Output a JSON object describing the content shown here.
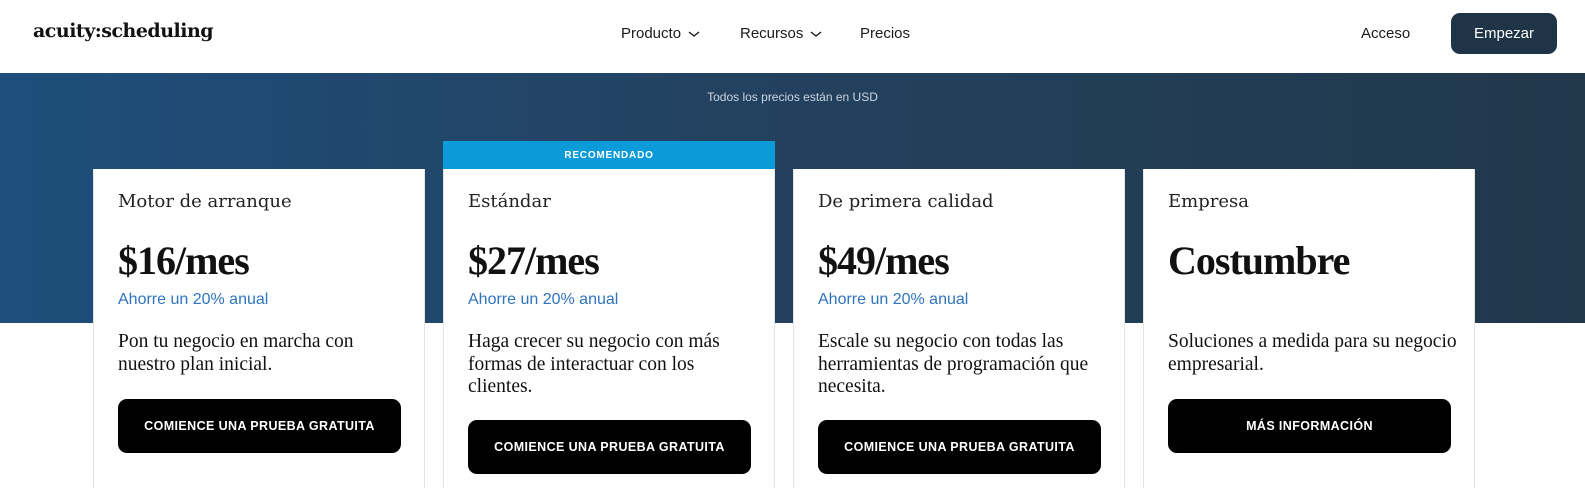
{
  "nav": {
    "logo": "acuity:scheduling",
    "items": [
      {
        "label": "Producto",
        "has_dropdown": true,
        "icon": "chevron-down-icon"
      },
      {
        "label": "Recursos",
        "has_dropdown": true,
        "icon": "chevron-down-icon"
      },
      {
        "label": "Precios",
        "has_dropdown": false
      }
    ],
    "login_label": "Acceso",
    "cta_label": "Empezar"
  },
  "hero": {
    "note": "Todos los precios están en USD"
  },
  "plans": [
    {
      "name": "Motor de arranque",
      "price": "$16/mes",
      "saving": "Ahorre un 20% anual",
      "description": "Pon tu negocio en marcha con nuestro plan inicial.",
      "button": "COMIENCE UNA PRUEBA GRATUITA"
    },
    {
      "badge": "RECOMENDADO",
      "name": "Estándar",
      "price": "$27/mes",
      "saving": "Ahorre un 20% anual",
      "description": "Haga crecer su negocio con más formas de interactuar con los clientes.",
      "button": "COMIENCE UNA PRUEBA GRATUITA"
    },
    {
      "name": "De primera calidad",
      "price": "$49/mes",
      "saving": "Ahorre un 20% anual",
      "description": "Escale su negocio con todas las herramientas de programación que necesita.",
      "button": "COMIENCE UNA PRUEBA GRATUITA"
    },
    {
      "name": "Empresa",
      "price": "Costumbre",
      "description": "Soluciones a medida para su negocio empresarial.",
      "button": "MÁS INFORMACIÓN"
    }
  ],
  "colors": {
    "brand_dark": "#1f3447",
    "recommended": "#0c9bd9",
    "saving_text": "#2f74c0",
    "button": "#000000"
  }
}
